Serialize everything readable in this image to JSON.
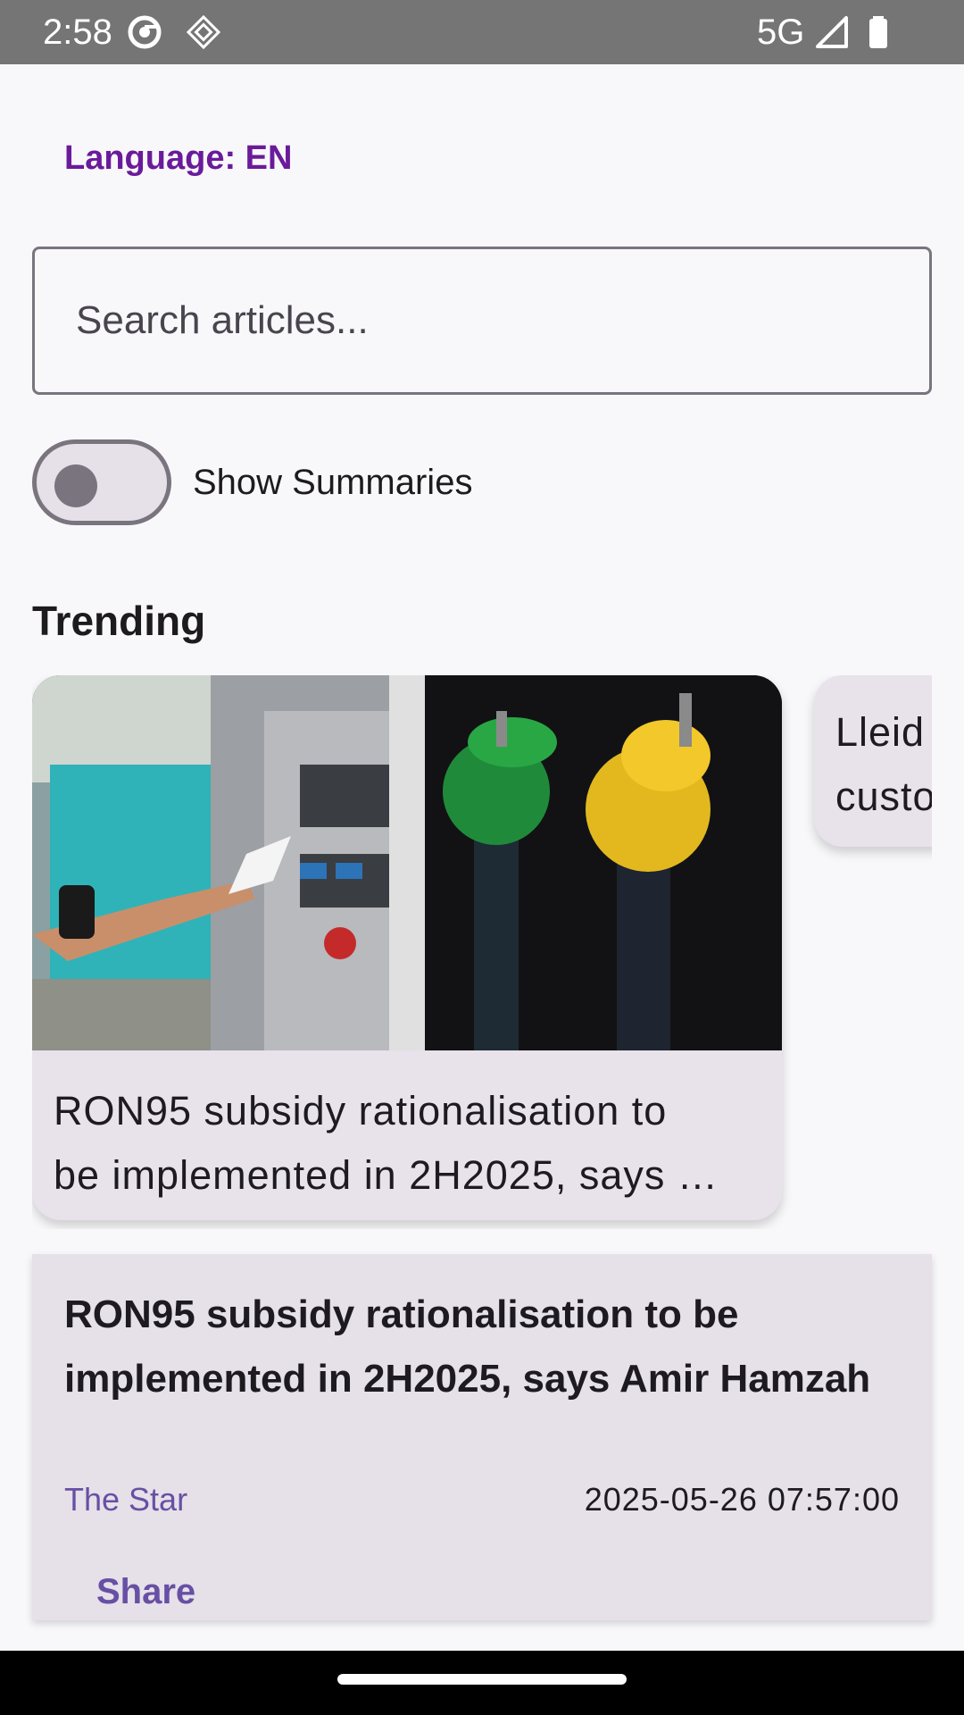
{
  "status_bar": {
    "time": "2:58",
    "network": "5G",
    "icons": [
      "chrome-icon",
      "sync-icon",
      "signal-icon",
      "battery-icon"
    ]
  },
  "language_label": "Language: EN",
  "search": {
    "placeholder": "Search articles..."
  },
  "summaries_toggle": {
    "label": "Show Summaries",
    "on": false
  },
  "trending": {
    "title": "Trending",
    "cards": [
      {
        "text": "RON95 subsidy rationalisation to\nbe implemented in 2H2025, says …",
        "image": "fuel-pump-nozzles-photo"
      },
      {
        "text": "Lleid\ncusto"
      }
    ]
  },
  "article": {
    "title": "RON95 subsidy rationalisation to be implemented in 2H2025, says Amir Hamzah",
    "source": "The Star",
    "datetime": "2025-05-26 07:57:00",
    "share_label": "Share"
  },
  "colors": {
    "accent": "#6750a4",
    "language": "#6a1b9a",
    "card_bg": "#e6e0e9",
    "status_bar": "#757575"
  }
}
